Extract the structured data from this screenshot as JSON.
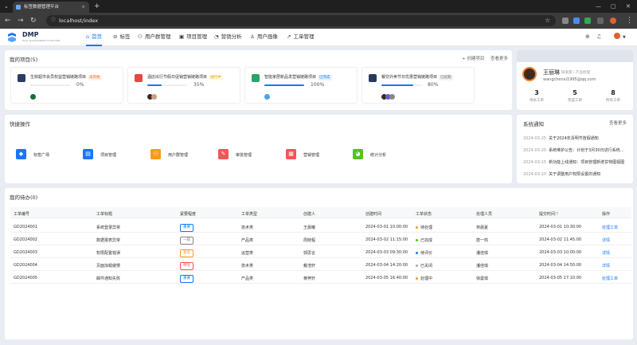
{
  "browser": {
    "tab_title": "标签数据管理平台",
    "url": "localhost/index"
  },
  "app": {
    "logo_text": "DMP",
    "logo_sub": "DATA MANAGEMENT PLATFORM",
    "nav": [
      {
        "label": "首页",
        "icon": "home-icon"
      },
      {
        "label": "标签",
        "icon": "tag-icon"
      },
      {
        "label": "用户群管理",
        "icon": "users-icon"
      },
      {
        "label": "项目管理",
        "icon": "project-icon"
      },
      {
        "label": "营销分析",
        "icon": "chart-icon"
      },
      {
        "label": "用户画像",
        "icon": "person-icon"
      },
      {
        "label": "工单管理",
        "icon": "ticket-icon"
      }
    ]
  },
  "projects": {
    "title": "我的项目(5)",
    "create_label": "+ 创建项目",
    "more_label": "查看更多",
    "items": [
      {
        "name": "生鲜超市会员权益营销链路项目",
        "status": "未开始",
        "progress": 0,
        "progress_label": "0%",
        "icon_color": "#2d3a66",
        "badge_bg": "#fff1e8",
        "badge_fg": "#f5622d"
      },
      {
        "name": "酒店出行节假日促销营销链路项目",
        "status": "进行中",
        "progress": 35,
        "progress_label": "35%",
        "icon_color": "#e84545",
        "badge_bg": "#fff8e1",
        "badge_fg": "#e0a100"
      },
      {
        "name": "智能家居新品发营销链路项目",
        "status": "已完成",
        "progress": 100,
        "progress_label": "100%",
        "icon_color": "#2ba36b",
        "badge_bg": "#e8f2ff",
        "badge_fg": "#1677ff"
      },
      {
        "name": "餐饮外卖节日优惠营销链路项目",
        "status": "已延期",
        "progress": 80,
        "progress_label": "80%",
        "icon_color": "#2a3a5c",
        "badge_bg": "#f2f2f2",
        "badge_fg": "#666"
      }
    ]
  },
  "user": {
    "name": "王丽琳",
    "role": "研发部 / 产品经理",
    "email": "wangchenxi1995@qq.com",
    "stats": [
      {
        "value": "3",
        "label": "待办工单"
      },
      {
        "value": "5",
        "label": "完成工单"
      },
      {
        "value": "8",
        "label": "所有工单"
      }
    ]
  },
  "quick": {
    "title": "快捷操作",
    "items": [
      {
        "label": "标签广场",
        "color": "#1677ff",
        "icon": "tag-square-icon"
      },
      {
        "label": "项目管理",
        "color": "#1677ff",
        "icon": "project-icon"
      },
      {
        "label": "用户群管理",
        "color": "#fa9a14",
        "icon": "users-icon"
      },
      {
        "label": "审批管理",
        "color": "#f25656",
        "icon": "approve-icon"
      },
      {
        "label": "营销管理",
        "color": "#f25656",
        "icon": "marketing-icon"
      },
      {
        "label": "统计分析",
        "color": "#52c41a",
        "icon": "stats-icon"
      }
    ]
  },
  "notices": {
    "title": "系统通知",
    "more_label": "查看更多",
    "items": [
      {
        "date": "2024-03-25",
        "text": "关于2024年清明节放假通知"
      },
      {
        "date": "2024-03-20",
        "text": "系统维护公告：计划于3月30日进行系统..."
      },
      {
        "date": "2024-03-15",
        "text": "新功能上线通知：项目管理新增甘特图视图"
      },
      {
        "date": "2024-03-10",
        "text": "关于调整用户权限设置的通知"
      }
    ]
  },
  "todo": {
    "title": "我的待办(0)",
    "columns": [
      "工单编号",
      "工单标题",
      "紧要程度",
      "工单类型",
      "创建人",
      "创建时间",
      "工单状态",
      "处理人员",
      "提交时间",
      "操作"
    ],
    "rows": [
      {
        "id": "GD2024001",
        "title": "系统登录异常",
        "priority": "重要",
        "p_color": "#1677ff",
        "type": "技术类",
        "creator": "王晨曦",
        "created": "2024-03-01 10:00:00",
        "status": "待处理",
        "s_color": "#fa9a14",
        "handler": "林晨夏",
        "submitted": "2024-03-01 10:30:00",
        "action": "处理工单"
      },
      {
        "id": "GD2024002",
        "title": "数据报表异常",
        "priority": "一般",
        "p_color": "#888888",
        "type": "产品类",
        "creator": "周晓程",
        "created": "2024-03-02 11:15:00",
        "status": "已完成",
        "s_color": "#52c41a",
        "handler": "唐一鸣",
        "submitted": "2024-03-02 11:45:00",
        "action": "详情"
      },
      {
        "id": "GD2024003",
        "title": "权限配置错误",
        "priority": "紧急",
        "p_color": "#fa9a14",
        "type": "运营类",
        "creator": "郭思言",
        "created": "2024-03-03 09:30:00",
        "status": "待评价",
        "s_color": "#1677ff",
        "handler": "潘佳琪",
        "submitted": "2024-03-03 10:00:00",
        "action": "详情"
      },
      {
        "id": "GD2024004",
        "title": "页面加载缓慢",
        "priority": "特急",
        "p_color": "#f25656",
        "type": "技术类",
        "creator": "戴浩轩",
        "created": "2024-03-04 14:20:00",
        "status": "已关闭",
        "s_color": "#aaaaaa",
        "handler": "潘佳琪",
        "submitted": "2024-03-04 14:50:00",
        "action": "详情"
      },
      {
        "id": "GD2024005",
        "title": "邮件通知失败",
        "priority": "重要",
        "p_color": "#1677ff",
        "type": "产品类",
        "creator": "黄梓轩",
        "created": "2024-03-05 16:40:00",
        "status": "处理中",
        "s_color": "#fa9a14",
        "handler": "徐曼琪",
        "submitted": "2024-03-05 17:10:00",
        "action": "处理工单"
      }
    ]
  }
}
